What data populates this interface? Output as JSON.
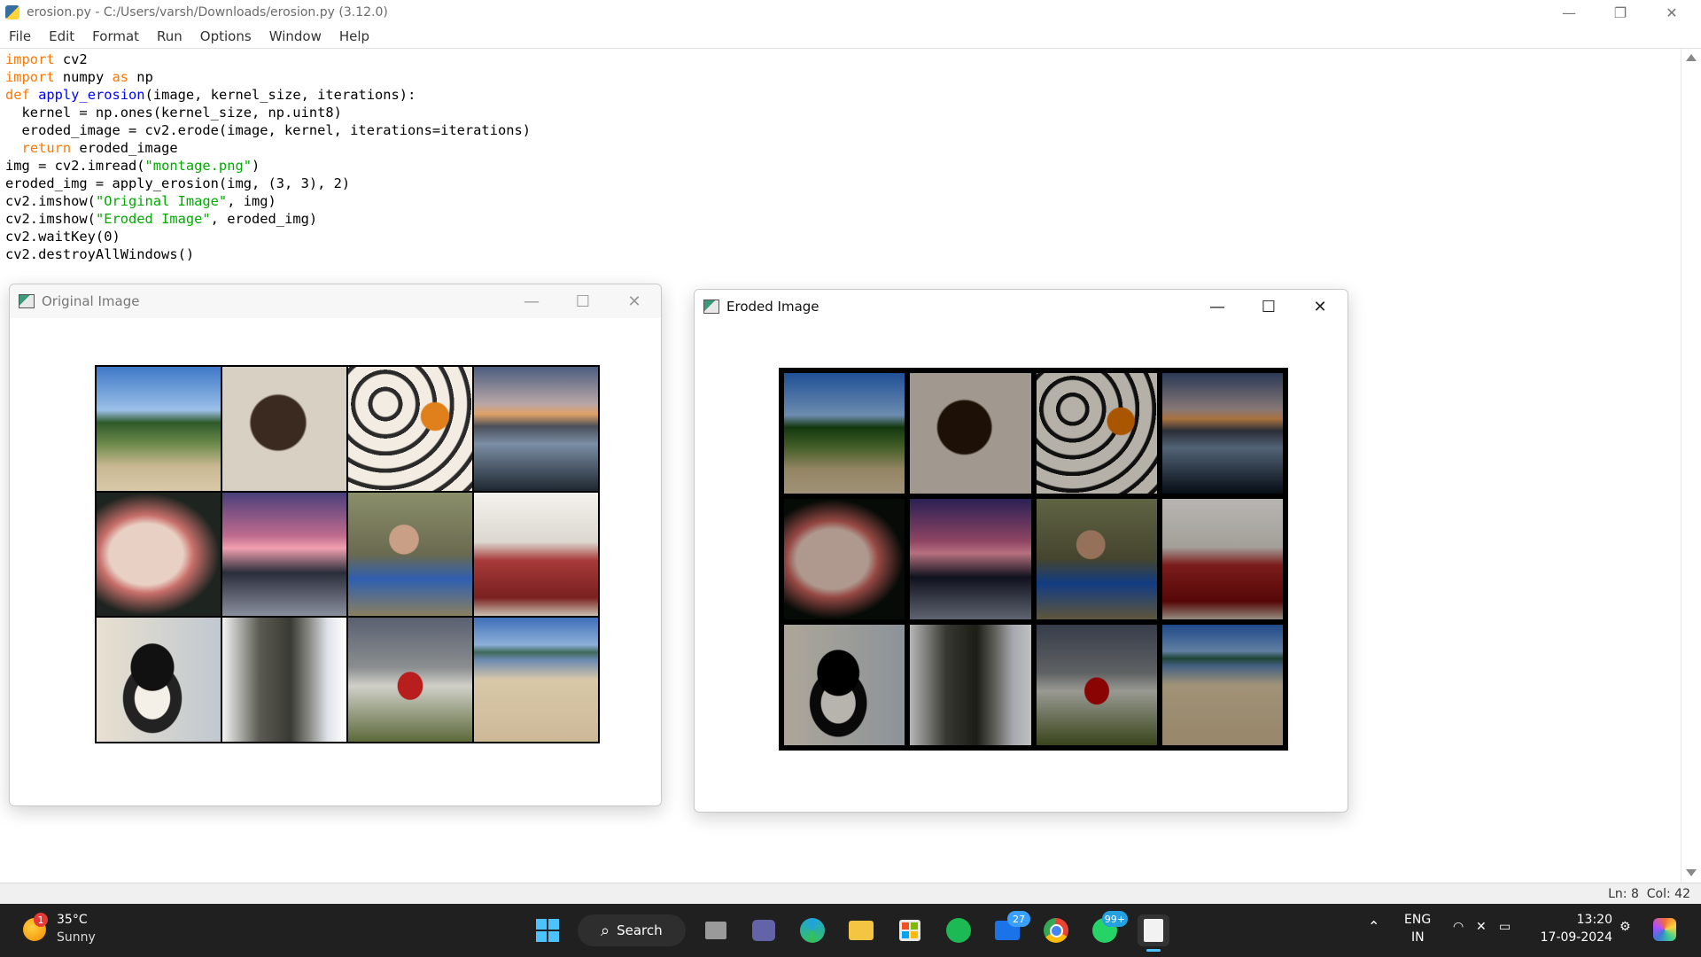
{
  "window": {
    "title": "erosion.py - C:/Users/varsh/Downloads/erosion.py (3.12.0)",
    "controls": [
      "—",
      "❐",
      "✕"
    ]
  },
  "menu": [
    "File",
    "Edit",
    "Format",
    "Run",
    "Options",
    "Window",
    "Help"
  ],
  "code_lines": [
    "import cv2",
    "import numpy as np",
    "def apply_erosion(image, kernel_size, iterations):",
    "  kernel = np.ones(kernel_size, np.uint8)",
    "  eroded_image = cv2.erode(image, kernel, iterations=iterations)",
    "  return eroded_image",
    "img = cv2.imread(\"montage.png\")",
    "eroded_img = apply_erosion(img, (3, 3), 2)",
    "cv2.imshow(\"Original Image\", img)",
    "cv2.imshow(\"Eroded Image\", eroded_img)",
    "cv2.waitKey(0)",
    "cv2.destroyAllWindows()"
  ],
  "status": {
    "line": "Ln: 8",
    "col": "Col: 42"
  },
  "original_window": {
    "title": "Original Image",
    "ctl_min": "—",
    "ctl_max": "☐",
    "ctl_close": "✕"
  },
  "eroded_window": {
    "title": "Eroded Image",
    "ctl_min": "—",
    "ctl_max": "☐",
    "ctl_close": "✕"
  },
  "montage_tiles": [
    {
      "name": "beach-cove",
      "bg": "linear-gradient(#3f78c8 0%, #9cc0e8 35%, #2f5a2a 45%, #6c8a4a 62%, #c9b892 80%, #d8c9a8 100%)"
    },
    {
      "name": "sleeping-cat",
      "bg": "radial-gradient(circle at 45% 45%, #3a2a20 0 28%, #d9d0c4 30%), linear-gradient(#ffffff, #9aa8c0)"
    },
    {
      "name": "cupcakes",
      "bg": "radial-gradient(circle at 70% 40%, #e0801a 0 12%, transparent 13%), repeating-radial-gradient(circle at 30% 30%, #f2ece2 0 10%, #2a2a2a 11% 14%)"
    },
    {
      "name": "lake-sunset",
      "bg": "linear-gradient(#4b5d7d 0%, #b9a7a7 30%, #e0a066 38%, #4a4f5a 48%, #7b8ea4 62%, #1e2730 100%)"
    },
    {
      "name": "fish-fillets",
      "bg": "radial-gradient(ellipse at 40% 50%, #e9d0c4 0 35%, #c86f6a 45%, #1e2420 70%)"
    },
    {
      "name": "pink-sky-trees",
      "bg": "linear-gradient(#4a3f7a 0%, #c06b8e 35%, #f0a0b0 45%, #2a2d3a 65%, #8a8f9e 100%)"
    },
    {
      "name": "baby-in-bucket",
      "bg": "radial-gradient(circle at 45% 38%, #c9a086 0 14%, transparent 15%), linear-gradient(#8a8f6a 0%, #6a6a50 50%, #2f5fb0 70%, #8a7f60 100%)"
    },
    {
      "name": "red-sofa",
      "bg": "linear-gradient(#f4f2ee 0%, #dcd8d0 40%, #a83a3a 55%, #7a2020 85%, #c9c0b0 100%)"
    },
    {
      "name": "penguin-toy",
      "bg": "radial-gradient(ellipse at 45% 40%, #111 0 22%, transparent 23%), radial-gradient(ellipse at 45% 65%, #f4f0e8 0 18%, #222 19% 30%, transparent 31%), linear-gradient(90deg,#e8e0d0,#c0c8d0)"
    },
    {
      "name": "shirts-hanging",
      "bg": "linear-gradient(90deg,#f4f4f4 0%, #5a5a52 30%, #3a3a34 55%, #8a8a84 70%, #dfe3ea 85%, #ffffff 100%)"
    },
    {
      "name": "fire-hydrant",
      "bg": "radial-gradient(ellipse at 50% 55%, #b81e1e 0 14%, transparent 15%), linear-gradient(#5a6070 0%, #8a8e90 40%, #d0d0c8 55%, #5c6a3a 100%)"
    },
    {
      "name": "sandy-beach",
      "bg": "linear-gradient(#3f6fb8 0%, #8db0d8 22%, #3e6a5a 28%, #6a8ab0 34%, #d8c8a8 50%, #cdb998 100%)"
    }
  ],
  "taskbar": {
    "weather_temp": "35°C",
    "weather_desc": "Sunny",
    "weather_badge": "1",
    "search_label": "Search",
    "teams_badge": "27",
    "whatsapp_badge": "99+",
    "lang": "ENG",
    "region": "IN",
    "time": "13:20",
    "date": "17-09-2024"
  }
}
